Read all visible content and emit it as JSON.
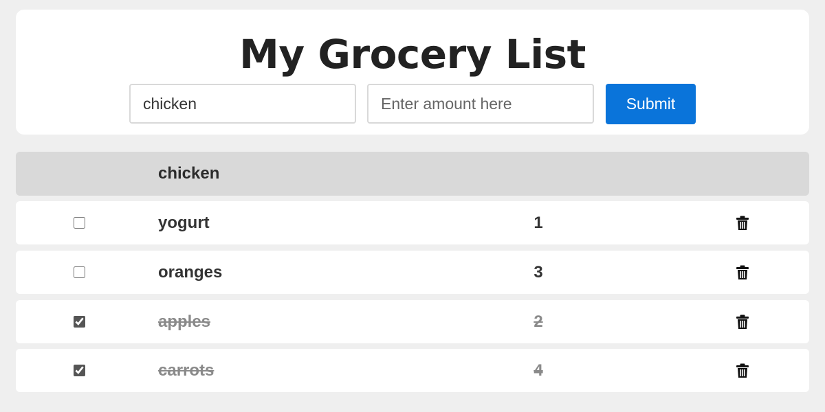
{
  "app": {
    "title": "My Grocery List"
  },
  "form": {
    "item_value": "chicken",
    "item_placeholder": "",
    "amount_value": "",
    "amount_placeholder": "Enter amount here",
    "submit_label": "Submit",
    "submit_color": "#0a74da"
  },
  "list": {
    "header_label": "chicken",
    "items": [
      {
        "name": "yogurt",
        "quantity": "1",
        "checked": false,
        "delete_icon": "trash-icon"
      },
      {
        "name": "oranges",
        "quantity": "3",
        "checked": false,
        "delete_icon": "trash-icon"
      },
      {
        "name": "apples",
        "quantity": "2",
        "checked": true,
        "delete_icon": "trash-icon"
      },
      {
        "name": "carrots",
        "quantity": "4",
        "checked": true,
        "delete_icon": "trash-icon"
      }
    ]
  }
}
